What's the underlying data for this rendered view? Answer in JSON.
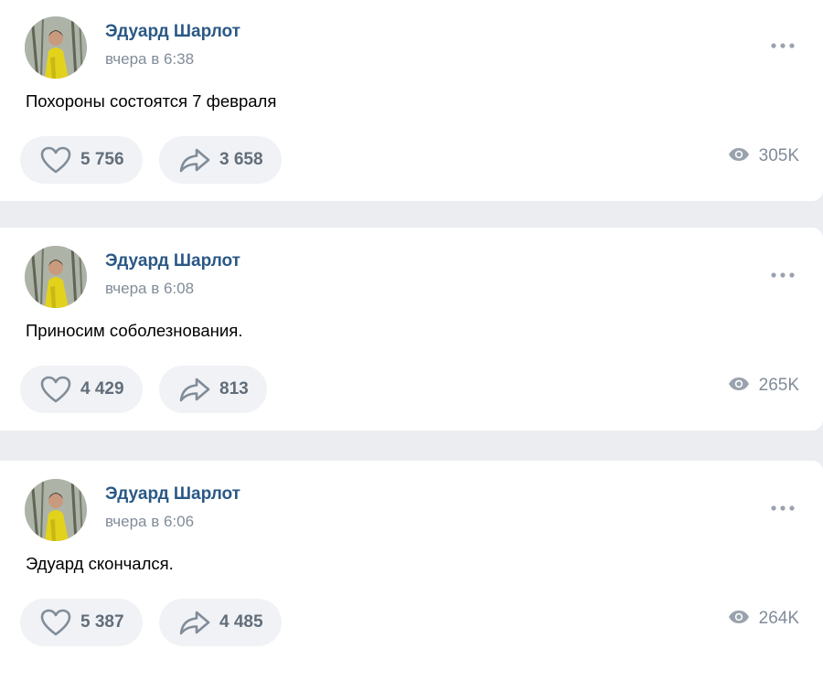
{
  "colors": {
    "page_background": "#ebedf0",
    "card_background": "#ffffff",
    "author_link": "#2a5885",
    "secondary_text": "#818c99",
    "button_background": "#f0f2f5",
    "button_text": "#626d7a"
  },
  "icons": {
    "like": "heart-icon",
    "share": "share-arrow-icon",
    "views": "eye-icon",
    "menu": "more-dots-icon"
  },
  "posts": [
    {
      "author": "Эдуард Шарлот",
      "time": "вчера в 6:38",
      "text": "Похороны состоятся 7 февраля",
      "likes": "5 756",
      "shares": "3 658",
      "views": "305K"
    },
    {
      "author": "Эдуард Шарлот",
      "time": "вчера в 6:08",
      "text": "Приносим соболезнования.",
      "likes": "4 429",
      "shares": "813",
      "views": "265K"
    },
    {
      "author": "Эдуард Шарлот",
      "time": "вчера в 6:06",
      "text": "Эдуард скончался.",
      "likes": "5 387",
      "shares": "4 485",
      "views": "264K"
    }
  ]
}
